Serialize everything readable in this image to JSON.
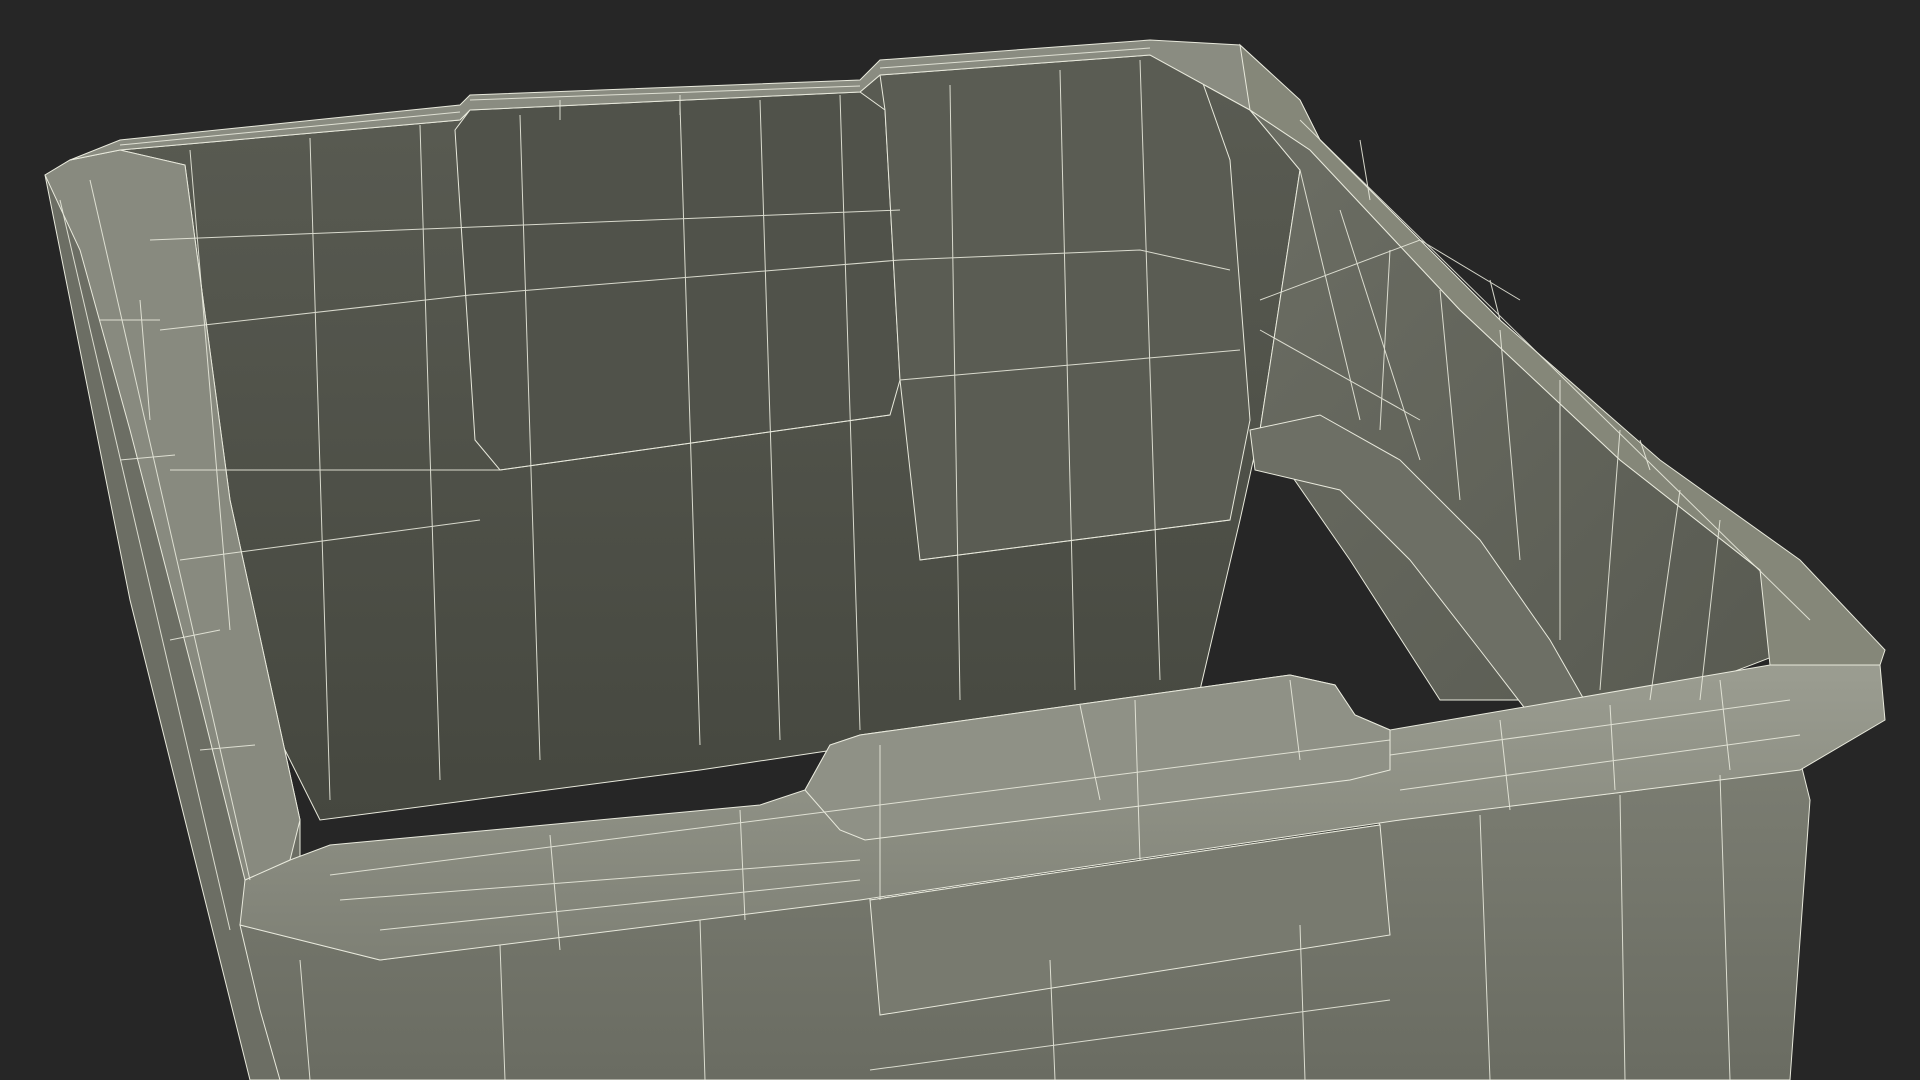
{
  "scene": {
    "subject": "wireframe-render-storage-bin",
    "colors": {
      "background": "#262626",
      "surface_light": "#8a8c80",
      "surface_mid": "#6f7168",
      "surface_dark": "#4b4d45",
      "surface_deep": "#3e403a",
      "rim_light": "#9a9c90",
      "wire": "#e8e9dc"
    }
  }
}
